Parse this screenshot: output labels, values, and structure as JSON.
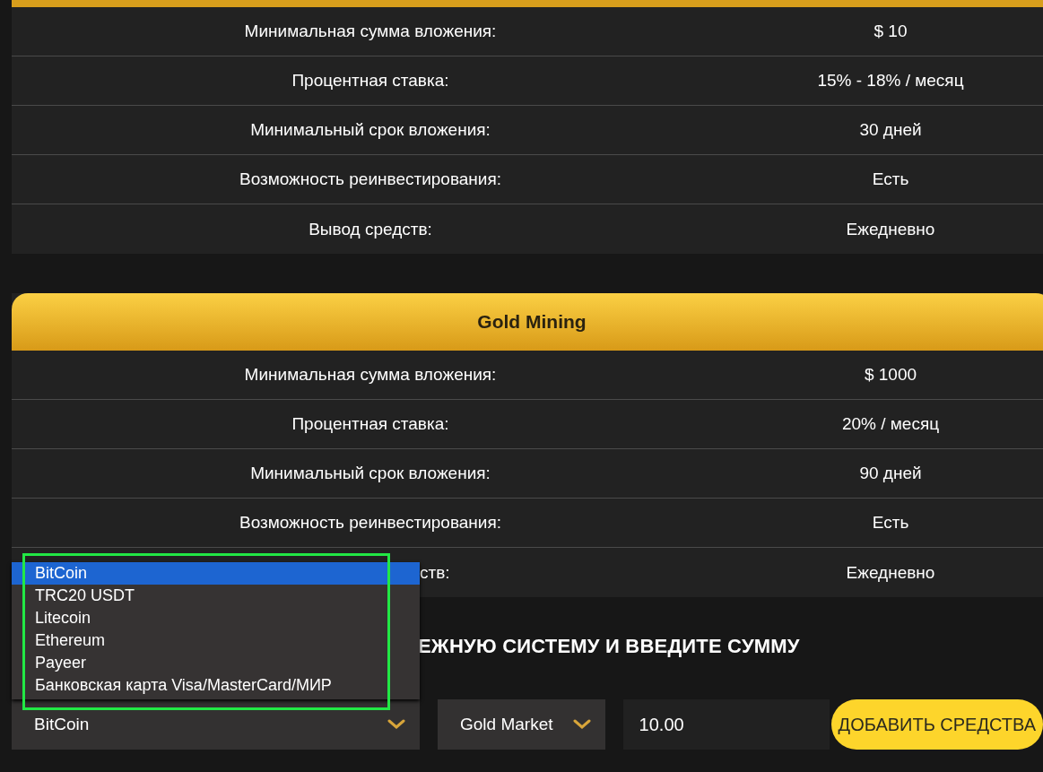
{
  "plans": [
    {
      "rows": [
        {
          "label": "Минимальная сумма вложения:",
          "value": "$ 10"
        },
        {
          "label": "Процентная ставка:",
          "value": "15% - 18% / месяц"
        },
        {
          "label": "Минимальный срок вложения:",
          "value": "30 дней"
        },
        {
          "label": "Возможность реинвестирования:",
          "value": "Есть"
        },
        {
          "label": "Вывод средств:",
          "value": "Ежедневно"
        }
      ]
    },
    {
      "title": "Gold Mining",
      "rows": [
        {
          "label": "Минимальная сумма вложения:",
          "value": "$ 1000"
        },
        {
          "label": "Процентная ставка:",
          "value": "20% / месяц"
        },
        {
          "label": "Минимальный срок вложения:",
          "value": "90 дней"
        },
        {
          "label": "Возможность реинвестирования:",
          "value": "Есть"
        },
        {
          "label": "ств:",
          "value": "Ежедневно",
          "partly_covered": true
        }
      ]
    }
  ],
  "deposit": {
    "heading": "ЕЖНУЮ СИСТЕМУ И ВВЕДИТЕ СУММУ",
    "payment_select": {
      "value": "BitCoin",
      "expanded": true,
      "options": [
        {
          "label": "BitCoin",
          "selected": true
        },
        {
          "label": "TRC20 USDT",
          "selected": false
        },
        {
          "label": "Litecoin",
          "selected": false
        },
        {
          "label": "Ethereum",
          "selected": false
        },
        {
          "label": "Payeer",
          "selected": false
        },
        {
          "label": "Банковская карта Visa/MasterCard/МИР",
          "selected": false
        }
      ]
    },
    "plan_select": {
      "value": "Gold Market"
    },
    "amount": {
      "value": "10.00"
    },
    "submit": "ДОБАВИТЬ СРЕДСТВА"
  }
}
